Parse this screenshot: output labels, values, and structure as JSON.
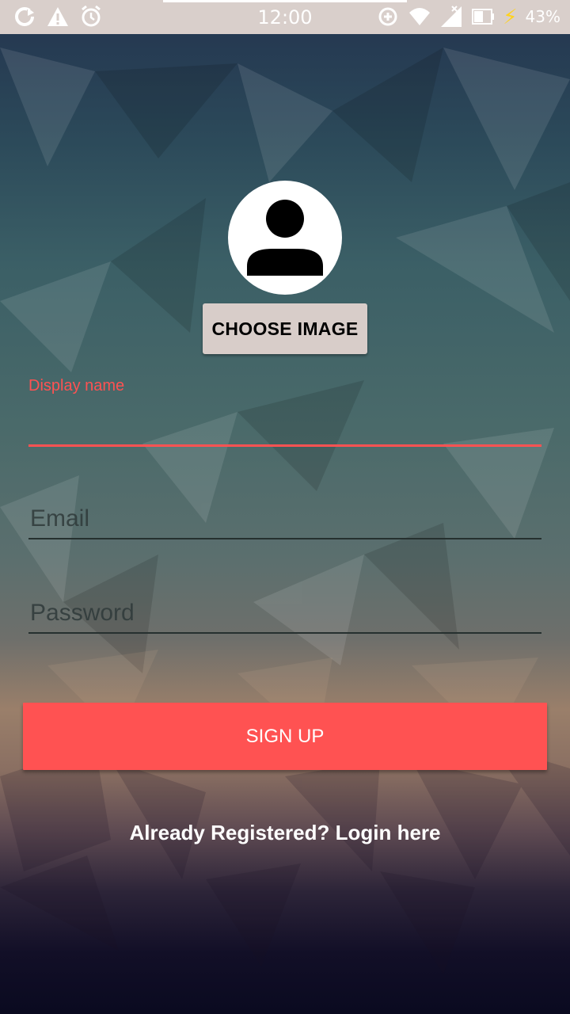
{
  "status_bar": {
    "time": "12:00",
    "battery_percent": "43%",
    "left_icons": [
      "sync-icon",
      "warning-icon",
      "alarm-icon"
    ],
    "right_icons": [
      "data-saver-icon",
      "wifi-icon",
      "signal-icon",
      "battery-icon",
      "charging-bolt-icon"
    ]
  },
  "profile": {
    "avatar_icon": "person-avatar-icon",
    "choose_image_label": "CHOOSE IMAGE"
  },
  "form": {
    "display_name": {
      "label": "Display name",
      "value": ""
    },
    "email": {
      "placeholder": "Email",
      "value": ""
    },
    "password": {
      "placeholder": "Password",
      "value": ""
    }
  },
  "actions": {
    "signup_label": "SIGN UP",
    "login_link_label": "Already Registered? Login here"
  },
  "colors": {
    "accent": "#ff5252",
    "status_bar": "#d9cfcb",
    "choose_button": "#d8cdc9",
    "text_light": "#ffffff"
  }
}
